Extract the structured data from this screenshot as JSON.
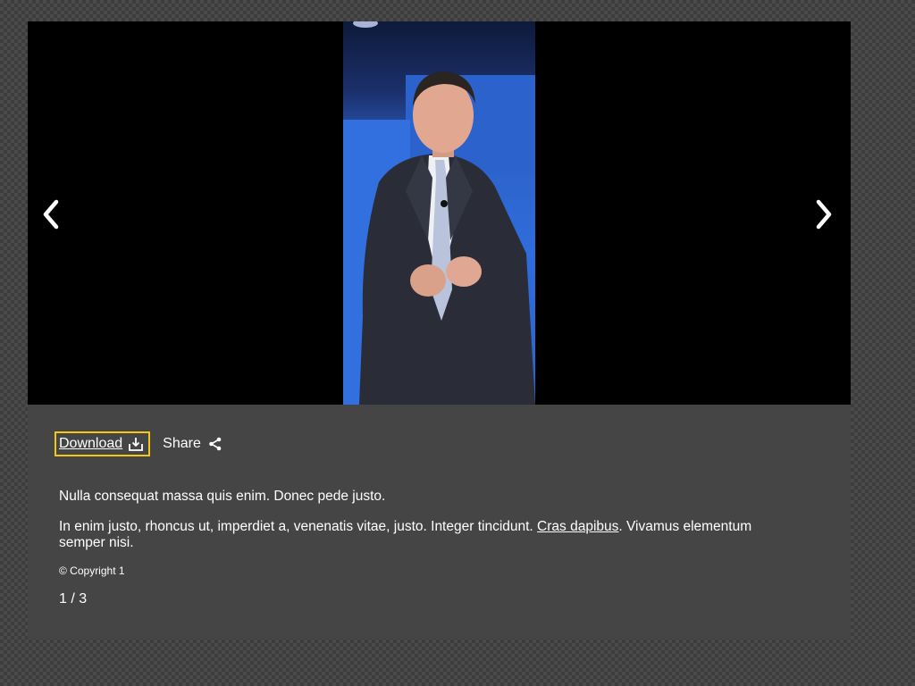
{
  "gallery": {
    "prev_icon": "chevron-left-icon",
    "next_icon": "chevron-right-icon",
    "image_colors": {
      "backdrop": "#000000",
      "stage_blue": "#2f6ddc"
    }
  },
  "actions": {
    "download_label": "Download",
    "download_icon": "download-icon",
    "share_label": "Share",
    "share_icon": "share-icon",
    "focus_color": "#f5c518"
  },
  "caption": {
    "line1": "Nulla consequat massa quis enim. Donec pede justo.",
    "line2_before": "In enim justo, rhoncus ut, imperdiet a, venenatis vitae, justo. Integer tincidunt. ",
    "line2_link": "Cras dapibus",
    "line2_after": ". Vivamus elementum semper nisi."
  },
  "copyright": "© Copyright 1",
  "counter": "1 / 3"
}
